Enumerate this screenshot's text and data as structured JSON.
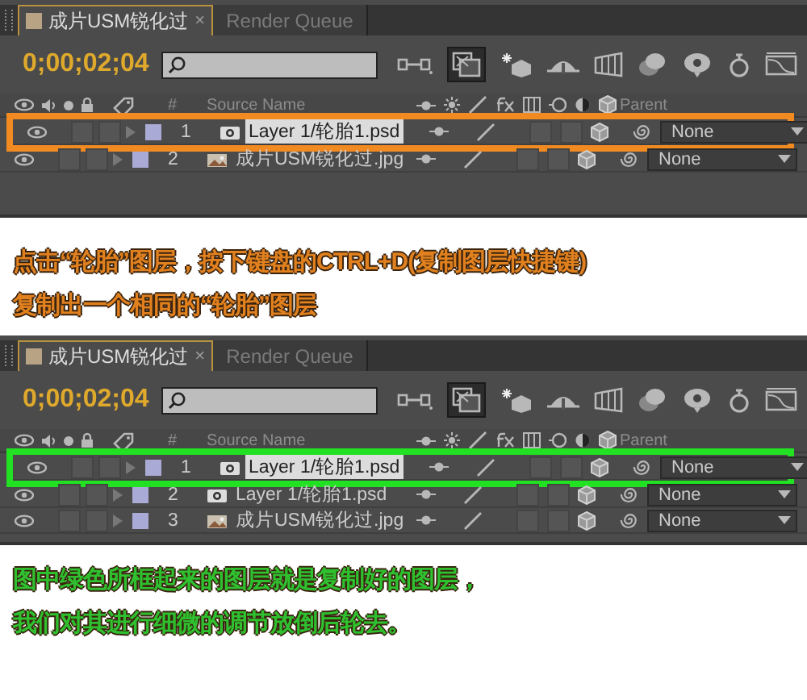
{
  "sections": [
    {
      "kind": "panel",
      "color": "#f28a22",
      "tabs": [
        {
          "label": "成片USM锐化过",
          "selected": true,
          "close": "×"
        },
        {
          "label": "Render Queue",
          "selected": false
        }
      ],
      "timecode": "0;00;02;04",
      "columns": {
        "number": "#",
        "source": "Source Name",
        "parent": "Parent"
      },
      "layers": [
        {
          "number": "1",
          "kind": "psd",
          "source_name": "Layer 1/轮胎1.psd",
          "parent": "None",
          "editing": true,
          "highlighted": true
        },
        {
          "number": "2",
          "kind": "jpg",
          "source_name": "成片USM锐化过.jpg",
          "parent": "None",
          "editing": false,
          "highlighted": false
        }
      ]
    },
    {
      "kind": "caption",
      "color": "#e0801e",
      "lines": [
        "点击“轮胎”图层，按下键盘的CTRL+D(复制图层快捷键)",
        "复制出一个相同的“轮胎”图层"
      ]
    },
    {
      "kind": "panel",
      "color": "#22e022",
      "tabs": [
        {
          "label": "成片USM锐化过",
          "selected": true,
          "close": "×"
        },
        {
          "label": "Render Queue",
          "selected": false
        }
      ],
      "timecode": "0;00;02;04",
      "columns": {
        "number": "#",
        "source": "Source Name",
        "parent": "Parent"
      },
      "layers": [
        {
          "number": "1",
          "kind": "psd",
          "source_name": "Layer 1/轮胎1.psd",
          "parent": "None",
          "editing": true,
          "highlighted": true
        },
        {
          "number": "2",
          "kind": "psd",
          "source_name": "Layer 1/轮胎1.psd",
          "parent": "None",
          "editing": false,
          "highlighted": false
        },
        {
          "number": "3",
          "kind": "jpg",
          "source_name": "成片USM锐化过.jpg",
          "parent": "None",
          "editing": false,
          "highlighted": false
        }
      ]
    },
    {
      "kind": "caption",
      "color": "#2fc02f",
      "lines": [
        "图中绿色所框起来的图层就是复制好的图层，",
        "我们对其进行细微的调节放倒后轮去。"
      ]
    }
  ]
}
